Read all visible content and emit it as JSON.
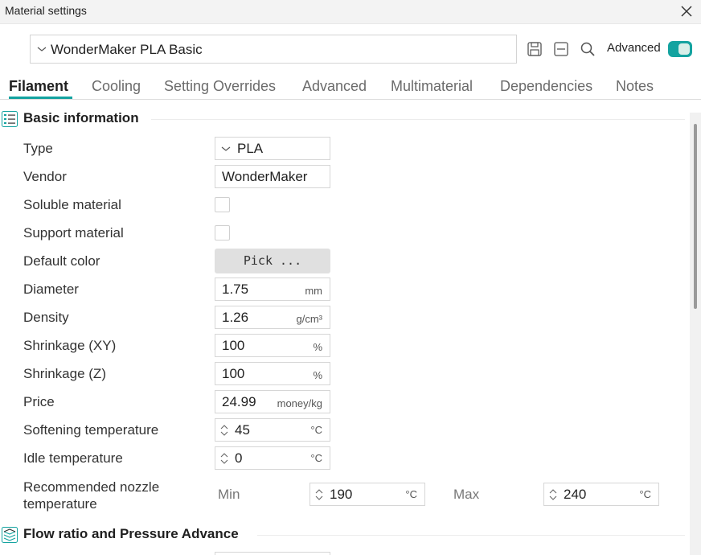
{
  "window": {
    "title": "Material settings"
  },
  "preset": {
    "value": "WonderMaker PLA Basic"
  },
  "toolbar": {
    "advanced_label": "Advanced",
    "advanced_on": true
  },
  "tabs": [
    {
      "label": "Filament",
      "active": true
    },
    {
      "label": "Cooling"
    },
    {
      "label": "Setting Overrides"
    },
    {
      "label": "Advanced"
    },
    {
      "label": "Multimaterial"
    },
    {
      "label": "Dependencies"
    },
    {
      "label": "Notes"
    }
  ],
  "basic": {
    "title": "Basic information",
    "type_label": "Type",
    "type_value": "PLA",
    "vendor_label": "Vendor",
    "vendor_value": "WonderMaker",
    "soluble_label": "Soluble material",
    "support_label": "Support material",
    "color_label": "Default color",
    "pick_label": "Pick ...",
    "diameter_label": "Diameter",
    "diameter_value": "1.75",
    "diameter_unit": "mm",
    "density_label": "Density",
    "density_value": "1.26",
    "density_unit": "g/cm³",
    "shrink_xy_label": "Shrinkage (XY)",
    "shrink_xy_value": "100",
    "shrink_xy_unit": "%",
    "shrink_z_label": "Shrinkage (Z)",
    "shrink_z_value": "100",
    "shrink_z_unit": "%",
    "price_label": "Price",
    "price_value": "24.99",
    "price_unit": "money/kg",
    "softening_label": "Softening temperature",
    "softening_value": "45",
    "softening_unit": "°C",
    "idle_label": "Idle temperature",
    "idle_value": "0",
    "idle_unit": "°C",
    "nozzle_label": "Recommended nozzle temperature",
    "min_label": "Min",
    "min_value": "190",
    "min_unit": "°C",
    "max_label": "Max",
    "max_value": "240",
    "max_unit": "°C"
  },
  "flow": {
    "title": "Flow ratio and Pressure Advance"
  }
}
